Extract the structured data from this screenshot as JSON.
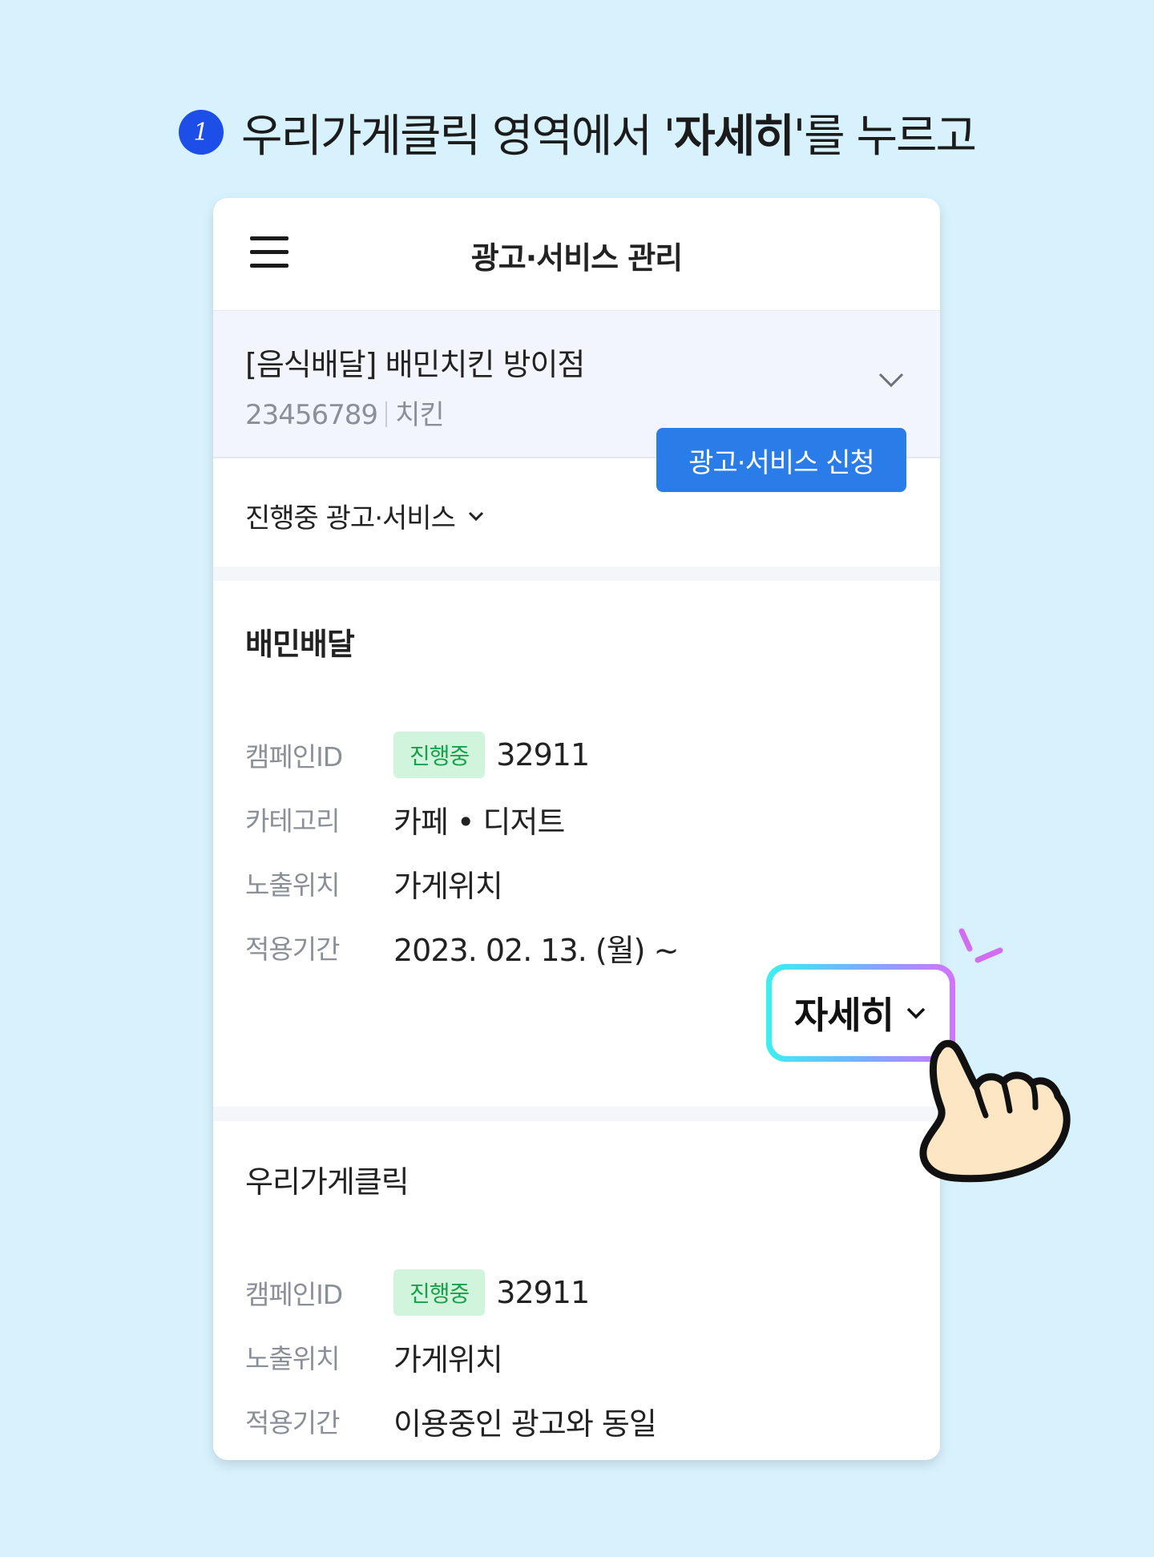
{
  "heading": {
    "step": "1",
    "text_pre": "우리가게클릭 영역에서 '",
    "text_bold": "자세히",
    "text_post": "'를 누르고"
  },
  "header": {
    "title": "광고·서비스 관리",
    "menu_icon": "hamburger-icon"
  },
  "store": {
    "name": "[음식배달] 배민치킨 방이점",
    "id": "23456789",
    "category": "치킨",
    "chevron_icon": "chevron-down-icon"
  },
  "filter": {
    "label": "진행중 광고·서비스",
    "apply_button": "광고·서비스 신청"
  },
  "sections": [
    {
      "title": "배민배달",
      "rows": [
        {
          "label": "캠페인ID",
          "badge": "진행중",
          "value": "32911"
        },
        {
          "label": "카테고리",
          "value": "카페 • 디저트"
        },
        {
          "label": "노출위치",
          "value": "가게위치"
        },
        {
          "label": "적용기간",
          "value": "2023. 02. 13. (월) ~"
        }
      ],
      "detail_button": "자세히"
    },
    {
      "title": "우리가게클릭",
      "rows": [
        {
          "label": "캠페인ID",
          "badge": "진행중",
          "value": "32911"
        },
        {
          "label": "노출위치",
          "value": "가게위치"
        },
        {
          "label": "적용기간",
          "value": "이용중인 광고와 동일"
        }
      ]
    }
  ],
  "colors": {
    "background": "#d7f1fd",
    "primary_button": "#2a7de9",
    "step_badge": "#1e4ee8",
    "status_badge_bg": "#d1f4dd",
    "status_badge_text": "#1aa04a"
  }
}
